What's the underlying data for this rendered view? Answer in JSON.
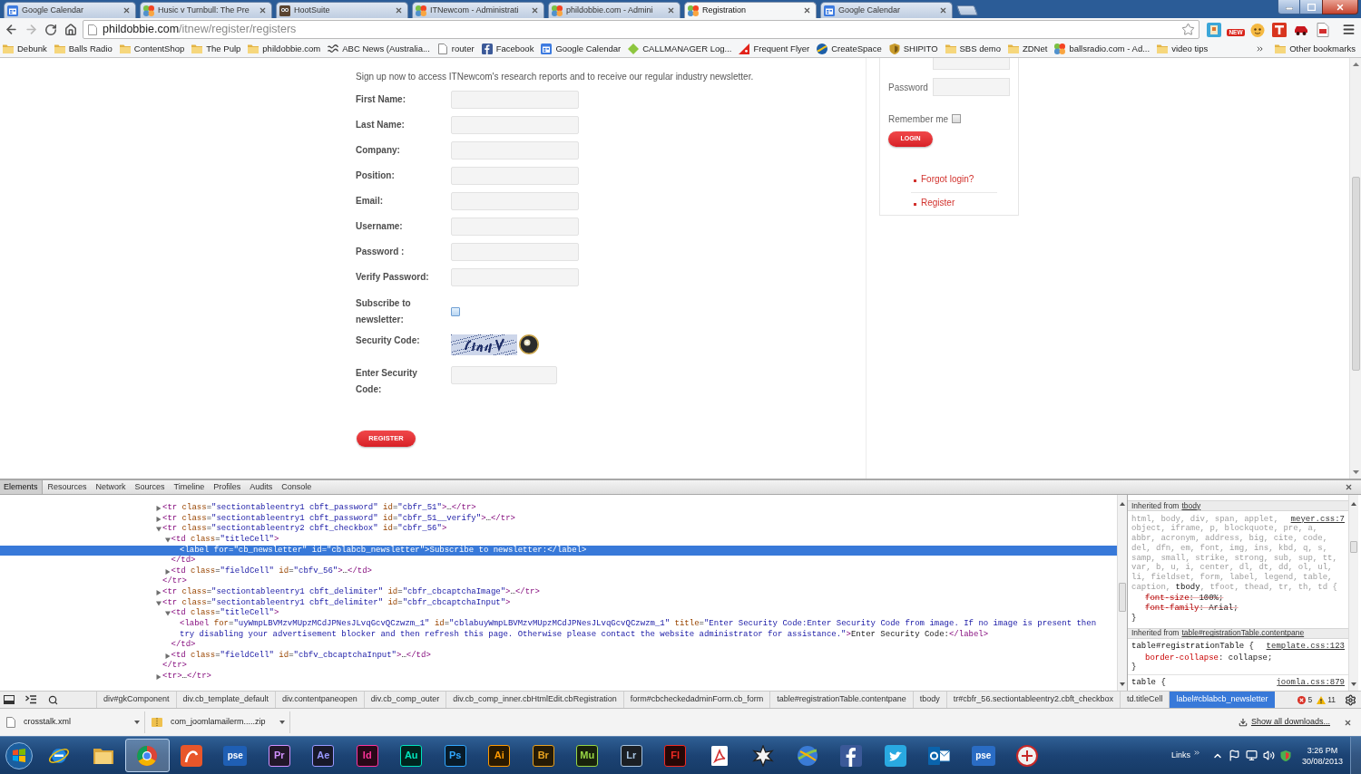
{
  "tabs": [
    {
      "title": "Google Calendar",
      "kind": "calendar",
      "selected": false
    },
    {
      "title": "Husic v Turnbull: The Pre",
      "kind": "pinwheel",
      "selected": false
    },
    {
      "title": "HootSuite",
      "kind": "owl",
      "selected": false
    },
    {
      "title": "ITNewcom - Administrati",
      "kind": "pinwheel",
      "selected": false
    },
    {
      "title": "phildobbie.com - Admini",
      "kind": "pinwheel",
      "selected": false
    },
    {
      "title": "Registration",
      "kind": "pinwheel",
      "selected": true
    },
    {
      "title": "Google Calendar",
      "kind": "calendar",
      "selected": false
    }
  ],
  "address_bar": {
    "host": "phildobbie.com",
    "path": "/itnew/register/registers",
    "extension_badge": "NEW"
  },
  "bookmarks": [
    {
      "label": "Debunk",
      "kind": "folder"
    },
    {
      "label": "Balls Radio",
      "kind": "folder"
    },
    {
      "label": "ContentShop",
      "kind": "folder"
    },
    {
      "label": "The Pulp",
      "kind": "folder"
    },
    {
      "label": "phildobbie.com",
      "kind": "folder"
    },
    {
      "label": "ABC News (Australia...",
      "kind": "wave"
    },
    {
      "label": "router",
      "kind": "page"
    },
    {
      "label": "Facebook",
      "kind": "f-logo"
    },
    {
      "label": "Google Calendar",
      "kind": "calendar"
    },
    {
      "label": "CALLMANAGER Log...",
      "kind": "diamond"
    },
    {
      "label": "Frequent Flyer",
      "kind": "triangle"
    },
    {
      "label": "CreateSpace",
      "kind": "globe"
    },
    {
      "label": "SHIPITO",
      "kind": "shield"
    },
    {
      "label": "SBS demo",
      "kind": "folder"
    },
    {
      "label": "ZDNet",
      "kind": "folder"
    },
    {
      "label": "ballsradio.com - Ad...",
      "kind": "pinwheel"
    },
    {
      "label": "video tips",
      "kind": "folder"
    }
  ],
  "other_bookmarks": "Other bookmarks",
  "page": {
    "intro": "Sign up now to access ITNewcom's research reports and to receive our regular industry newsletter.",
    "fields": [
      {
        "label": "First Name:",
        "kind": "text"
      },
      {
        "label": "Last Name:",
        "kind": "text"
      },
      {
        "label": "Company:",
        "kind": "text"
      },
      {
        "label": "Position:",
        "kind": "text"
      },
      {
        "label": "Email:",
        "kind": "text"
      },
      {
        "label": "Username:",
        "kind": "text"
      },
      {
        "label": "Password :",
        "kind": "text"
      },
      {
        "label": "Verify Password:",
        "kind": "text"
      },
      {
        "label": "Subscribe to newsletter:",
        "kind": "checkbox",
        "checked": false
      },
      {
        "label": "Security Code:",
        "kind": "captcha"
      },
      {
        "label": "Enter Security Code:",
        "kind": "code"
      }
    ],
    "register_button": "REGISTER",
    "login": {
      "password_label": "Password",
      "remember_label": "Remember me",
      "remember_checked": false,
      "login_button": "LOGIN",
      "links": [
        "Forgot login?",
        "Register"
      ]
    }
  },
  "devtools": {
    "tabs": [
      {
        "label": "Elements",
        "selected": true
      },
      {
        "label": "Resources",
        "selected": false
      },
      {
        "label": "Network",
        "selected": false
      },
      {
        "label": "Sources",
        "selected": false
      },
      {
        "label": "Timeline",
        "selected": false
      },
      {
        "label": "Profiles",
        "selected": false
      },
      {
        "label": "Audits",
        "selected": false
      },
      {
        "label": "Console",
        "selected": false
      }
    ],
    "tree": [
      {
        "kind": "parent",
        "expanded": false,
        "selected": false,
        "text": "<tr class=\"sectiontableentry1 cbft_password\" id=\"cbfr_51\">…</tr>"
      },
      {
        "kind": "parent",
        "expanded": false,
        "selected": false,
        "text": "<tr class=\"sectiontableentry1 cbft_password\" id=\"cbfr_51__verify\">…</tr>"
      },
      {
        "kind": "parent",
        "expanded": true,
        "selected": false,
        "text": "<tr class=\"sectiontableentry2 cbft_checkbox\" id=\"cbfr_56\">",
        "children": [
          {
            "kind": "parent",
            "expanded": true,
            "selected": false,
            "text": "<td class=\"titleCell\">",
            "children": [
              {
                "kind": "leaf",
                "selected": true,
                "text": "<label for=\"cb_newsletter\" id=\"cblabcb_newsletter\">Subscribe to newsletter:</label>"
              }
            ],
            "close": "</td>"
          },
          {
            "kind": "parent",
            "expanded": false,
            "selected": false,
            "text": "<td class=\"fieldCell\" id=\"cbfv_56\">…</td>"
          }
        ],
        "close": "</tr>"
      },
      {
        "kind": "parent",
        "expanded": false,
        "selected": false,
        "text": "<tr class=\"sectiontableentry1 cbft_delimiter\" id=\"cbfr_cbcaptchaImage\">…</tr>"
      },
      {
        "kind": "parent",
        "expanded": true,
        "selected": false,
        "text": "<tr class=\"sectiontableentry1 cbft_delimiter\" id=\"cbfr_cbcaptchaInput\">",
        "children": [
          {
            "kind": "parent",
            "expanded": true,
            "selected": false,
            "text": "<td class=\"titleCell\">",
            "children": [
              {
                "kind": "leaf",
                "selected": false,
                "text": "<label for=\"uyWmpLBVMzvMUpzMCdJPNesJLvqGcvQCzwzm_1\" id=\"cblabuyWmpLBVMzvMUpzMCdJPNesJLvqGcvQCzwzm_1\" title=\"Enter Security Code:Enter Security Code from image. If no image is present then try disabling your advertisement blocker and then refresh this page. Otherwise please contact the website administrator for assistance.\">Enter Security Code:</label>"
              }
            ],
            "close": "</td>"
          },
          {
            "kind": "parent",
            "expanded": false,
            "selected": false,
            "text": "<td class=\"fieldCell\" id=\"cbfv_cbcaptchaInput\">…</td>"
          }
        ],
        "close": "</tr>"
      },
      {
        "kind": "parent",
        "expanded": false,
        "selected": false,
        "text": "<tr>…</tr>"
      }
    ],
    "styles": [
      {
        "label": "Inherited from",
        "link": "tbody",
        "rules": [
          {
            "source": "meyer.css:7",
            "selector_parts": [
              {
                "text": "html, body, div, span, applet, object, iframe, p, blockquote, pre, a, abbr, acronym, address, big, cite, code, del, dfn, em, font, img, ins, kbd, q, s, samp, small, strike, strong, sub, sup, tt, var, b, u, i, center, dl, dt, dd, ol, ul, li, fieldset, form, label, legend, table, caption, ",
                "matched": false
              },
              {
                "text": "tbody",
                "matched": true
              },
              {
                "text": ", tfoot, thead, tr, th, td {",
                "matched": false
              }
            ],
            "declarations": [
              {
                "text": "font-size: 100%;",
                "overridden": true
              },
              {
                "text": "font-family: Arial;",
                "overridden": true
              }
            ],
            "close": "}"
          }
        ]
      },
      {
        "label": "Inherited from",
        "link": "table#registrationTable.contentpane",
        "rules": [
          {
            "source": "template.css:123",
            "selector_parts": [
              {
                "text": "table#registrationTable {",
                "matched": true
              }
            ],
            "declarations": [
              {
                "text": "border-collapse: collapse;",
                "overridden": false
              }
            ],
            "close": "}"
          },
          {
            "source": "joomla.css:879",
            "selector_parts": [
              {
                "text": "table {",
                "matched": true
              }
            ]
          }
        ]
      }
    ],
    "breadcrumbs": [
      {
        "label": "div#gkComponent",
        "selected": false
      },
      {
        "label": "div.cb_template_default",
        "selected": false
      },
      {
        "label": "div.contentpaneopen",
        "selected": false
      },
      {
        "label": "div.cb_comp_outer",
        "selected": false
      },
      {
        "label": "div.cb_comp_inner.cbHtmlEdit.cbRegistration",
        "selected": false
      },
      {
        "label": "form#cbcheckedadminForm.cb_form",
        "selected": false
      },
      {
        "label": "table#registrationTable.contentpane",
        "selected": false
      },
      {
        "label": "tbody",
        "selected": false
      },
      {
        "label": "tr#cbfr_56.sectiontableentry2.cbft_checkbox",
        "selected": false
      },
      {
        "label": "td.titleCell",
        "selected": false
      },
      {
        "label": "label#cblabcb_newsletter",
        "selected": true
      }
    ],
    "error_count": "5",
    "warning_count": "11"
  },
  "downloads": {
    "items": [
      {
        "name": "crosstalk.xml",
        "kind": "document"
      },
      {
        "name": "com_joomlamailerm.....zip",
        "kind": "archive"
      }
    ],
    "show_all": "Show all downloads..."
  },
  "taskbar": {
    "apps": [
      {
        "kind": "browser-e",
        "selected": false
      },
      {
        "kind": "folder",
        "selected": false
      },
      {
        "kind": "browser-circle",
        "selected": true
      },
      {
        "kind": "app-r",
        "selected": false
      },
      {
        "kind": "filled-tile",
        "label": "pse",
        "color": "#1f5fb4",
        "selected": false
      },
      {
        "kind": "label-tile",
        "label": "Pr",
        "color": "#d291ff",
        "selected": false
      },
      {
        "kind": "label-tile",
        "label": "Ae",
        "color": "#9999ff",
        "selected": false
      },
      {
        "kind": "label-tile",
        "label": "Id",
        "color": "#ff3399",
        "selected": false
      },
      {
        "kind": "label-tile",
        "label": "Au",
        "color": "#00e4bb",
        "selected": false
      },
      {
        "kind": "label-tile",
        "label": "Ps",
        "color": "#31a8ff",
        "selected": false
      },
      {
        "kind": "label-tile",
        "label": "Ai",
        "color": "#ff9a00",
        "selected": false
      },
      {
        "kind": "label-tile",
        "label": "Br",
        "color": "#e8a220",
        "selected": false
      },
      {
        "kind": "label-tile",
        "label": "Mu",
        "color": "#96d444",
        "selected": false
      },
      {
        "kind": "label-tile",
        "label": "Lr",
        "color": "#a7c4e0",
        "selected": false
      },
      {
        "kind": "label-tile",
        "label": "Fl",
        "color": "#ee2a24",
        "selected": false
      },
      {
        "kind": "pdf",
        "selected": false
      },
      {
        "kind": "starburst",
        "selected": false
      },
      {
        "kind": "globe",
        "selected": false
      },
      {
        "kind": "f-logo",
        "selected": false
      },
      {
        "kind": "bird",
        "selected": false
      },
      {
        "kind": "mail",
        "selected": false
      },
      {
        "kind": "filled-tile",
        "label": "pse",
        "color": "#2a6cc4",
        "selected": false
      },
      {
        "kind": "round-app",
        "selected": false
      }
    ],
    "links_label": "Links",
    "time": "3:26 PM",
    "date": "30/08/2013"
  }
}
